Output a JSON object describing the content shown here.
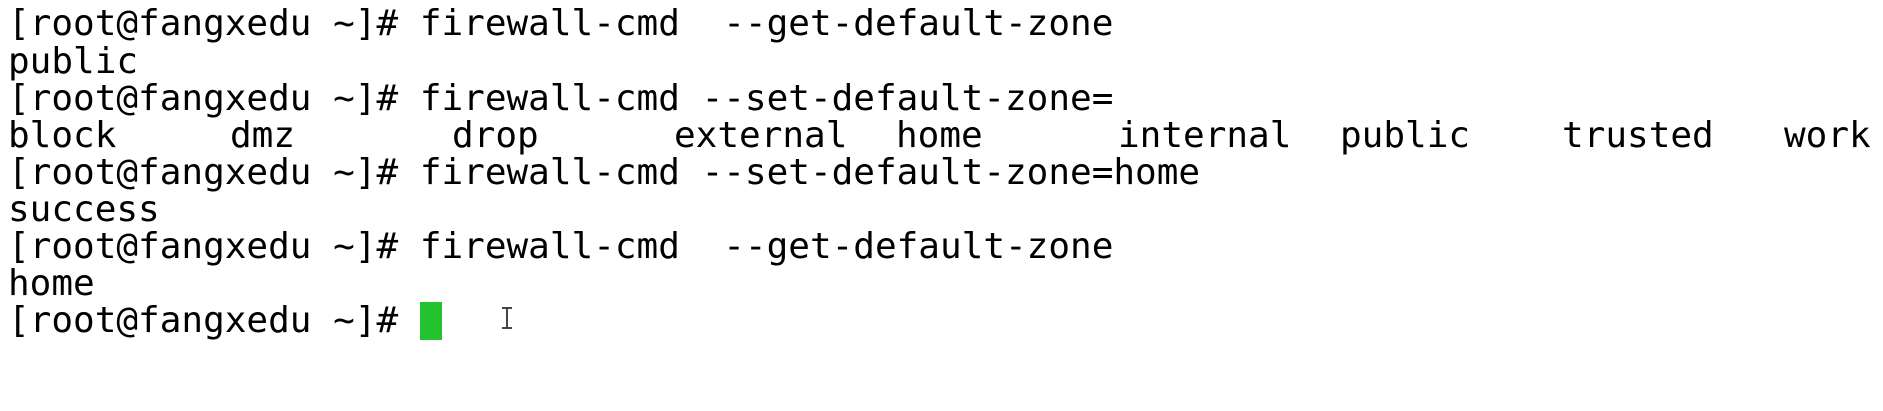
{
  "terminal": {
    "lines": [
      {
        "prompt": "[root@fangxedu ~]# ",
        "command": "firewall-cmd  --get-default-zone"
      },
      {
        "output": "public"
      },
      {
        "prompt": "[root@fangxedu ~]# ",
        "command": "firewall-cmd --set-default-zone="
      },
      {
        "prompt": "[root@fangxedu ~]# ",
        "command": "firewall-cmd --set-default-zone=home"
      },
      {
        "output": "success"
      },
      {
        "prompt": "[root@fangxedu ~]# ",
        "command": "firewall-cmd  --get-default-zone"
      },
      {
        "output": "home"
      },
      {
        "prompt": "[root@fangxedu ~]# ",
        "command": ""
      }
    ],
    "zone_completions": [
      "block",
      "dmz",
      "drop",
      "external",
      "home",
      "internal",
      "public",
      "trusted",
      "work"
    ],
    "cursor_color": "#22c32e",
    "text_color": "#000000",
    "background_color": "#ffffff"
  }
}
